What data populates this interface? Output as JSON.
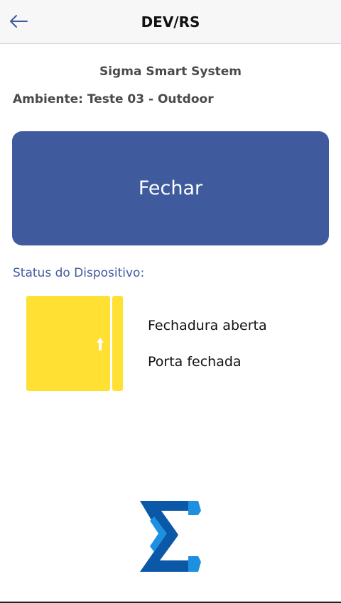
{
  "header": {
    "title": "DEV/RS",
    "back_icon": "arrow-left-icon"
  },
  "info": {
    "system_name": "Sigma Smart System",
    "ambiente": "Ambiente: Teste 03 - Outdoor"
  },
  "action": {
    "label": "Fechar",
    "color": "#3f5b9e"
  },
  "status": {
    "label": "Status do Dispositivo:",
    "lock_state": "Fechadura aberta",
    "door_state": "Porta fechada",
    "door_color": "#ffe033",
    "door_icon": "door-icon"
  },
  "brand": {
    "logo_icon": "sigma-logo-icon",
    "primary_color": "#0b57a8",
    "accent_color": "#1e90e0"
  }
}
